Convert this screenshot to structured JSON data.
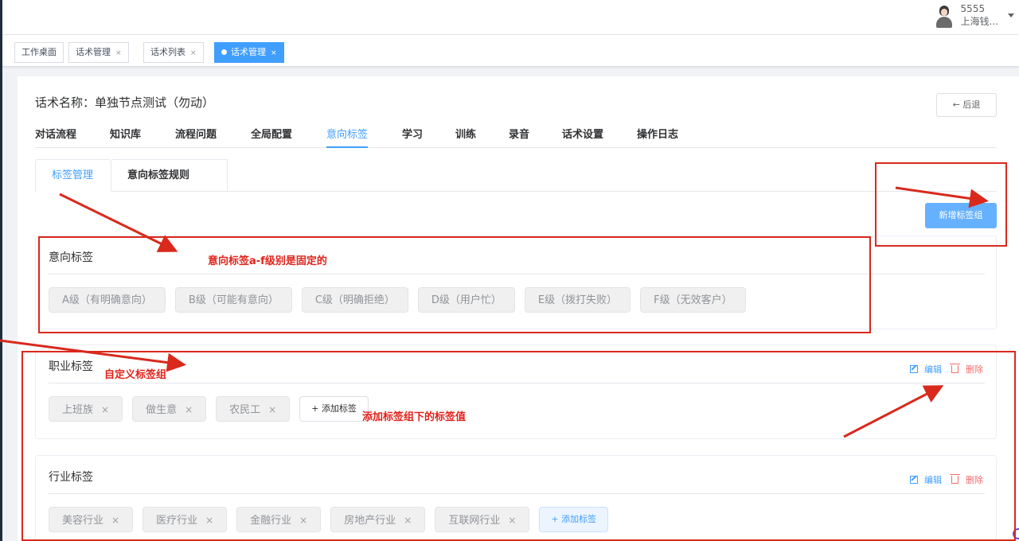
{
  "user": {
    "name": "5555",
    "org": "上海钱..."
  },
  "open_tabs": [
    {
      "label": "工作桌面",
      "closable": false
    },
    {
      "label": "话术管理",
      "closable": true
    },
    {
      "label": "话术列表",
      "closable": true
    },
    {
      "label": "话术管理",
      "closable": true,
      "active": true
    }
  ],
  "close_glyph": "×",
  "script": {
    "title": "话术名称：单独节点测试（勿动）",
    "back_label": "← 后退"
  },
  "nav_tabs": [
    "对话流程",
    "知识库",
    "流程问题",
    "全局配置",
    "意向标签",
    "学习",
    "训练",
    "录音",
    "话术设置",
    "操作日志"
  ],
  "nav_active": "意向标签",
  "sub_tabs": [
    "标签管理",
    "意向标签规则"
  ],
  "add_group_label": "新增标签组",
  "intent_group": {
    "title": "意向标签",
    "tags": [
      "A级（有明确意向）",
      "B级（可能有意向）",
      "C级（明确拒绝）",
      "D级（用户忙）",
      "E级（拨打失败）",
      "F级（无效客户）"
    ]
  },
  "custom_groups": [
    {
      "title": "职业标签",
      "tags": [
        "上班族",
        "做生意",
        "农民工"
      ],
      "add_label": "+ 添加标签",
      "edit_label": "编辑",
      "delete_label": "删除"
    },
    {
      "title": "行业标签",
      "tags": [
        "美容行业",
        "医疗行业",
        "金融行业",
        "房地产行业",
        "互联网行业"
      ],
      "add_label": "+ 添加标签",
      "edit_label": "编辑",
      "delete_label": "删除"
    }
  ],
  "annotations": {
    "fixed_note": "意向标签a-f级别是固定的",
    "custom_note": "自定义标签组",
    "add_value_note": "添加标签组下的标签值",
    "color": "#d9291c"
  },
  "colors": {
    "accent": "#409eff",
    "danger": "#f56c6c",
    "annotation": "#d9291c"
  }
}
